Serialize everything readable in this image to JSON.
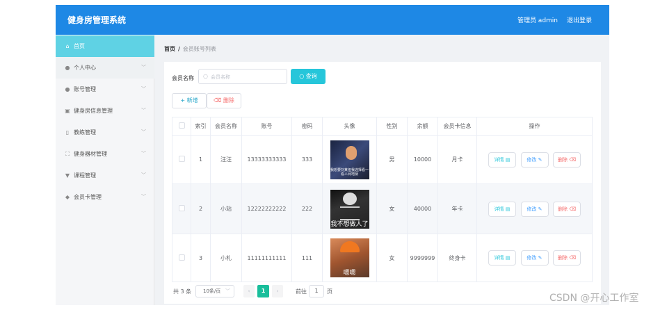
{
  "app": {
    "title": "健身房管理系统",
    "user": "管理员 admin",
    "logout": "退出登录"
  },
  "sidebar": {
    "items": [
      {
        "label": "首页",
        "icon": "home-icon"
      },
      {
        "label": "个人中心",
        "icon": "user-icon"
      },
      {
        "label": "账号管理",
        "icon": "user-icon"
      },
      {
        "label": "健身房信息管理",
        "icon": "picture-icon"
      },
      {
        "label": "教练管理",
        "icon": "phone-icon"
      },
      {
        "label": "健身器材管理",
        "icon": "fullscreen-icon"
      },
      {
        "label": "课程管理",
        "icon": "trophy-icon"
      },
      {
        "label": "会员卡管理",
        "icon": "location-icon"
      }
    ]
  },
  "breadcrumb": {
    "home": "首页",
    "separator": "/",
    "current": "会员账号列表"
  },
  "search": {
    "label": "会员名称",
    "placeholder": "会员名称",
    "button": "查询"
  },
  "actions": {
    "add": "+ 新增",
    "delete": "删除"
  },
  "table": {
    "headers": [
      "",
      "索引",
      "会员名称",
      "账号",
      "密码",
      "头像",
      "性别",
      "余额",
      "会员卡信息",
      "操作"
    ],
    "rows": [
      {
        "index": "1",
        "name": "汪汪",
        "account": "13333333333",
        "password": "333",
        "avatar_caption": "我想要刘某但我选择看一看人间地狱",
        "gender": "男",
        "balance": "10000",
        "card": "月卡"
      },
      {
        "index": "2",
        "name": "小站",
        "account": "12222222222",
        "password": "222",
        "avatar_caption": "我不想做人了",
        "gender": "女",
        "balance": "40000",
        "card": "年卡"
      },
      {
        "index": "3",
        "name": "小札",
        "account": "11111111111",
        "password": "111",
        "avatar_caption": "嗯嗯",
        "gender": "女",
        "balance": "9999999",
        "card": "终身卡"
      }
    ],
    "row_actions": {
      "detail": "详情",
      "edit": "修改",
      "remove": "删除"
    }
  },
  "pagination": {
    "total": "共 3 条",
    "page_size": "10条/页",
    "current_page": "1",
    "goto_label": "前往",
    "goto_value": "1",
    "page_suffix": "页"
  },
  "watermark": "CSDN @开心工作室",
  "colors": {
    "header": "#1e88e5",
    "active_nav": "#5fd2e4",
    "query_button": "#26c6da",
    "current_page": "#19be9b"
  }
}
